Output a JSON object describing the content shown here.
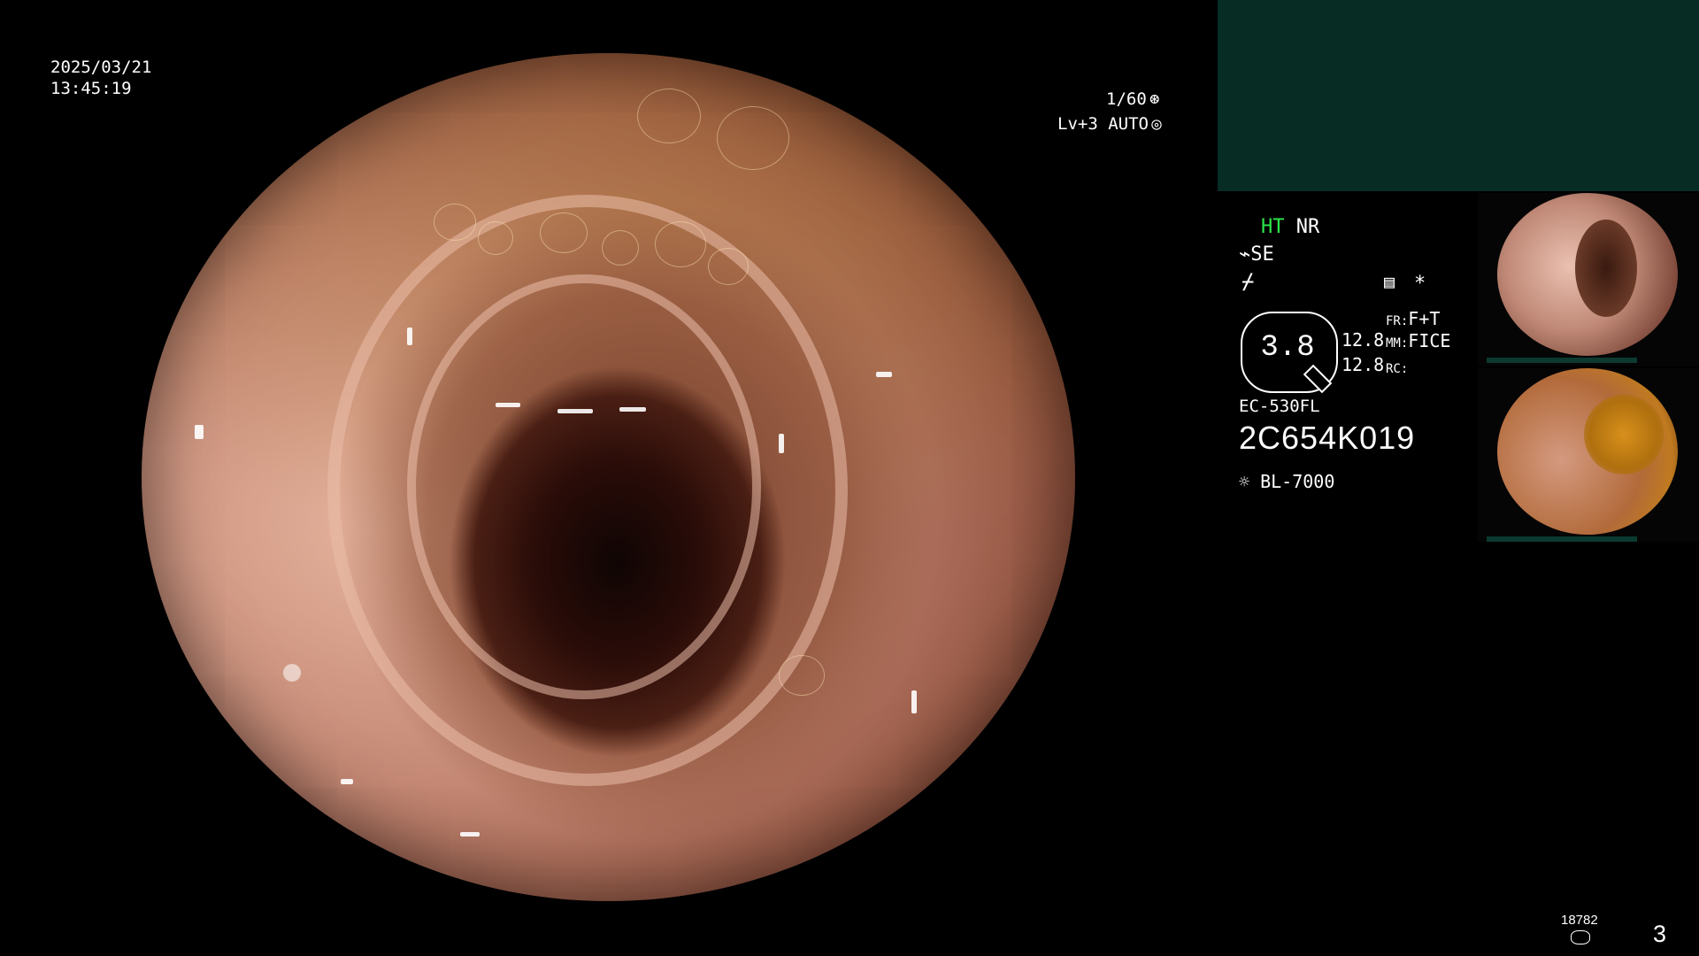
{
  "overlay": {
    "date": "2025/03/21",
    "time": "13:45:19",
    "shutter": "1/60",
    "iris_level": "Lv+3 AUTO"
  },
  "status": {
    "ht": "HT",
    "nr": "NR",
    "se": "SE",
    "zoom": "3.8",
    "val1": "12.8",
    "val2": "12.8",
    "fr_label": "FR:",
    "fr_value": "F+T",
    "mm_label": "MM:",
    "mm_value": "FICE",
    "rc_label": "RC:",
    "scope_model": "EC-530FL",
    "serial": "2C654K019",
    "light_source": "BL-7000",
    "asterisk": "*"
  },
  "thumbnails": [
    {
      "name": "thumbnail-1",
      "tint": "#c28a78"
    },
    {
      "name": "thumbnail-2",
      "tint": "#b26a3a"
    }
  ],
  "footer": {
    "image_count": "18782",
    "page": "3"
  },
  "colors": {
    "accent_green": "#2de84a",
    "panel_teal": "#062c24"
  },
  "icons": {
    "shutter": "aperture-icon",
    "auto": "target-icon",
    "structure": "structure-enhance-icon",
    "color": "color-mode-icon",
    "settings": "memo-icon",
    "light": "sun-icon",
    "storage": "disk-icon"
  }
}
